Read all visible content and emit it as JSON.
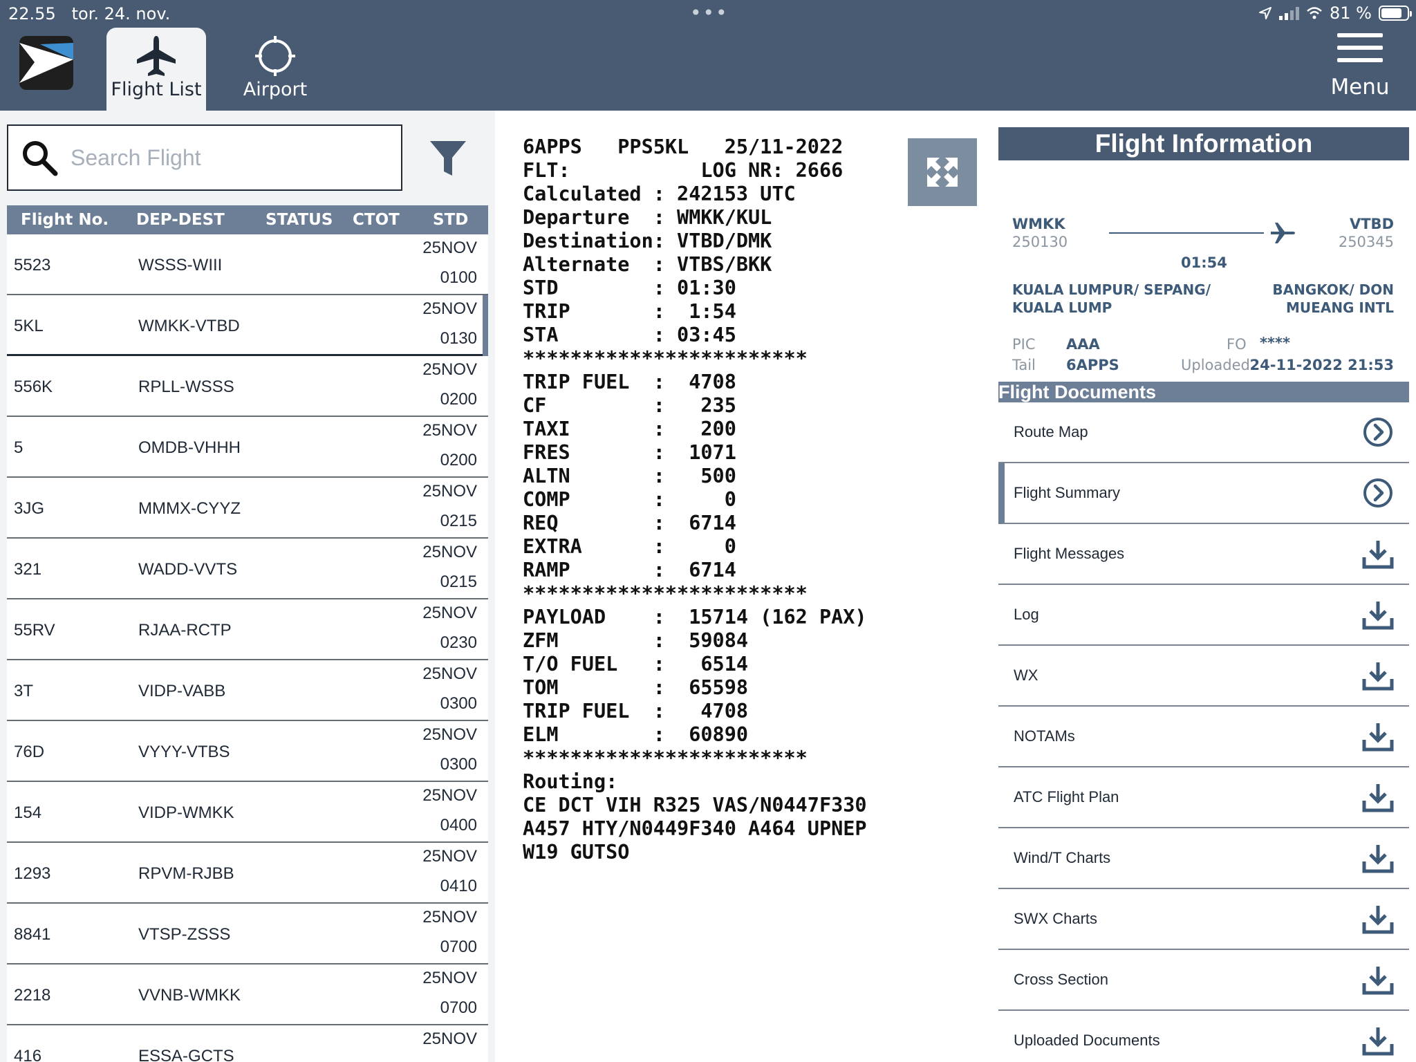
{
  "status_bar": {
    "time": "22.55",
    "date": "tor. 24. nov.",
    "dots": "•••",
    "battery": "81 %",
    "battery_level": 0.81
  },
  "nav": {
    "tabs": [
      {
        "label": "Flight List",
        "icon": "airplane-icon",
        "active": true
      },
      {
        "label": "Airport",
        "icon": "crosshair-icon",
        "active": false
      }
    ],
    "menu_label": "Menu"
  },
  "search": {
    "placeholder": "Search Flight",
    "value": ""
  },
  "flight_table": {
    "columns": [
      "Flight No.",
      "DEP-DEST",
      "STATUS",
      "CTOT",
      "STD"
    ],
    "rows": [
      {
        "no": "5523",
        "route": "WSSS-WIII",
        "date": "25NOV",
        "time": "0100"
      },
      {
        "no": "5KL",
        "route": "WMKK-VTBD",
        "date": "25NOV",
        "time": "0130",
        "selected": true
      },
      {
        "no": "556K",
        "route": "RPLL-WSSS",
        "date": "25NOV",
        "time": "0200"
      },
      {
        "no": "5",
        "route": "OMDB-VHHH",
        "date": "25NOV",
        "time": "0200"
      },
      {
        "no": "3JG",
        "route": "MMMX-CYYZ",
        "date": "25NOV",
        "time": "0215"
      },
      {
        "no": "321",
        "route": "WADD-VVTS",
        "date": "25NOV",
        "time": "0215"
      },
      {
        "no": "55RV",
        "route": "RJAA-RCTP",
        "date": "25NOV",
        "time": "0230"
      },
      {
        "no": "3T",
        "route": "VIDP-VABB",
        "date": "25NOV",
        "time": "0300"
      },
      {
        "no": "76D",
        "route": "VYYY-VTBS",
        "date": "25NOV",
        "time": "0300"
      },
      {
        "no": "154",
        "route": "VIDP-WMKK",
        "date": "25NOV",
        "time": "0400"
      },
      {
        "no": "1293",
        "route": "RPVM-RJBB",
        "date": "25NOV",
        "time": "0410"
      },
      {
        "no": "8841",
        "route": "VTSP-ZSSS",
        "date": "25NOV",
        "time": "0700"
      },
      {
        "no": "2218",
        "route": "VVNB-WMKK",
        "date": "25NOV",
        "time": "0700"
      },
      {
        "no": "416",
        "route": "ESSA-GCTS",
        "date": "25NOV",
        "time": ""
      }
    ]
  },
  "ofp_text": "6APPS   PPS5KL   25/11-2022\nFLT:           LOG NR: 2666\nCalculated : 242153 UTC\nDeparture  : WMKK/KUL\nDestination: VTBD/DMK\nAlternate  : VTBS/BKK\nSTD        : 01:30\nTRIP       :  1:54\nSTA        : 03:45\n************************\nTRIP FUEL  :  4708\nCF         :   235\nTAXI       :   200\nFRES       :  1071\nALTN       :   500\nCOMP       :     0\nREQ        :  6714\nEXTRA      :     0\nRAMP       :  6714\n************************\nPAYLOAD    :  15714 (162 PAX)\nZFM        :  59084\nT/O FUEL   :   6514\nTOM        :  65598\nTRIP FUEL  :   4708\nELM        :  60890\n************************\nRouting:\nCE DCT VIH R325 VAS/N0447F330\nA457 HTY/N0449F340 A464 UPNEP\nW19 GUTSO",
  "flight_info": {
    "title": "Flight Information",
    "dep_code": "WMKK",
    "dep_num": "250130",
    "dest_code": "VTBD",
    "dest_num": "250345",
    "duration": "01:54",
    "dep_name": "KUALA LUMPUR/ SEPANG/\nKUALA LUMP",
    "dest_name": "BANGKOK/ DON\nMUEANG INTL",
    "pic_label": "PIC",
    "pic_value": "AAA",
    "fo_label": "FO",
    "fo_value": "****",
    "tail_label": "Tail",
    "tail_value": "6APPS",
    "uploaded_label": "Uploaded",
    "uploaded_value": "24-11-2022 21:53"
  },
  "documents": {
    "title": "Flight Documents",
    "items": [
      {
        "label": "Route Map",
        "icon": "chevron-circle-icon"
      },
      {
        "label": "Flight Summary",
        "icon": "chevron-circle-icon",
        "selected": true
      },
      {
        "label": "Flight Messages",
        "icon": "download-icon"
      },
      {
        "label": "Log",
        "icon": "download-icon"
      },
      {
        "label": "WX",
        "icon": "download-icon"
      },
      {
        "label": "NOTAMs",
        "icon": "download-icon"
      },
      {
        "label": "ATC Flight Plan",
        "icon": "download-icon"
      },
      {
        "label": "Wind/T Charts",
        "icon": "download-icon"
      },
      {
        "label": "SWX Charts",
        "icon": "download-icon"
      },
      {
        "label": "Cross Section",
        "icon": "download-icon"
      },
      {
        "label": "Uploaded Documents",
        "icon": "download-icon"
      }
    ]
  },
  "colors": {
    "nav_bg": "#495b73",
    "header_bg": "#6d7f96",
    "accent_text": "#3d5a78",
    "panel_bg": "#f1f3f5"
  }
}
